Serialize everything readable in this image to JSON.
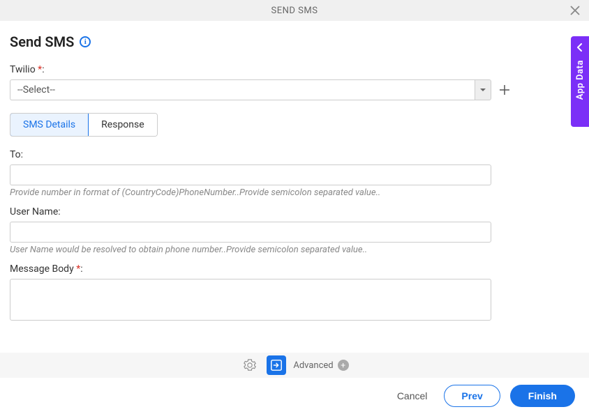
{
  "header": {
    "title": "SEND SMS"
  },
  "page": {
    "title": "Send SMS"
  },
  "form": {
    "twilio_label": "Twilio",
    "twilio_select_placeholder": "--Select--",
    "to_label": "To:",
    "to_value": "",
    "to_helper": "Provide number in format of (CountryCode)PhoneNumber..Provide semicolon separated value..",
    "username_label": "User Name:",
    "username_value": "",
    "username_helper": "User Name would be resolved to obtain phone number..Provide semicolon separated value..",
    "message_body_label": "Message Body",
    "message_body_value": ""
  },
  "tabs": {
    "sms_details": "SMS Details",
    "response": "Response"
  },
  "toolbar": {
    "advanced_label": "Advanced"
  },
  "buttons": {
    "cancel": "Cancel",
    "prev": "Prev",
    "finish": "Finish"
  },
  "side_panel": {
    "label": "App Data"
  },
  "colors": {
    "accent": "#1a73e8",
    "side_tab": "#7b2ff7"
  }
}
